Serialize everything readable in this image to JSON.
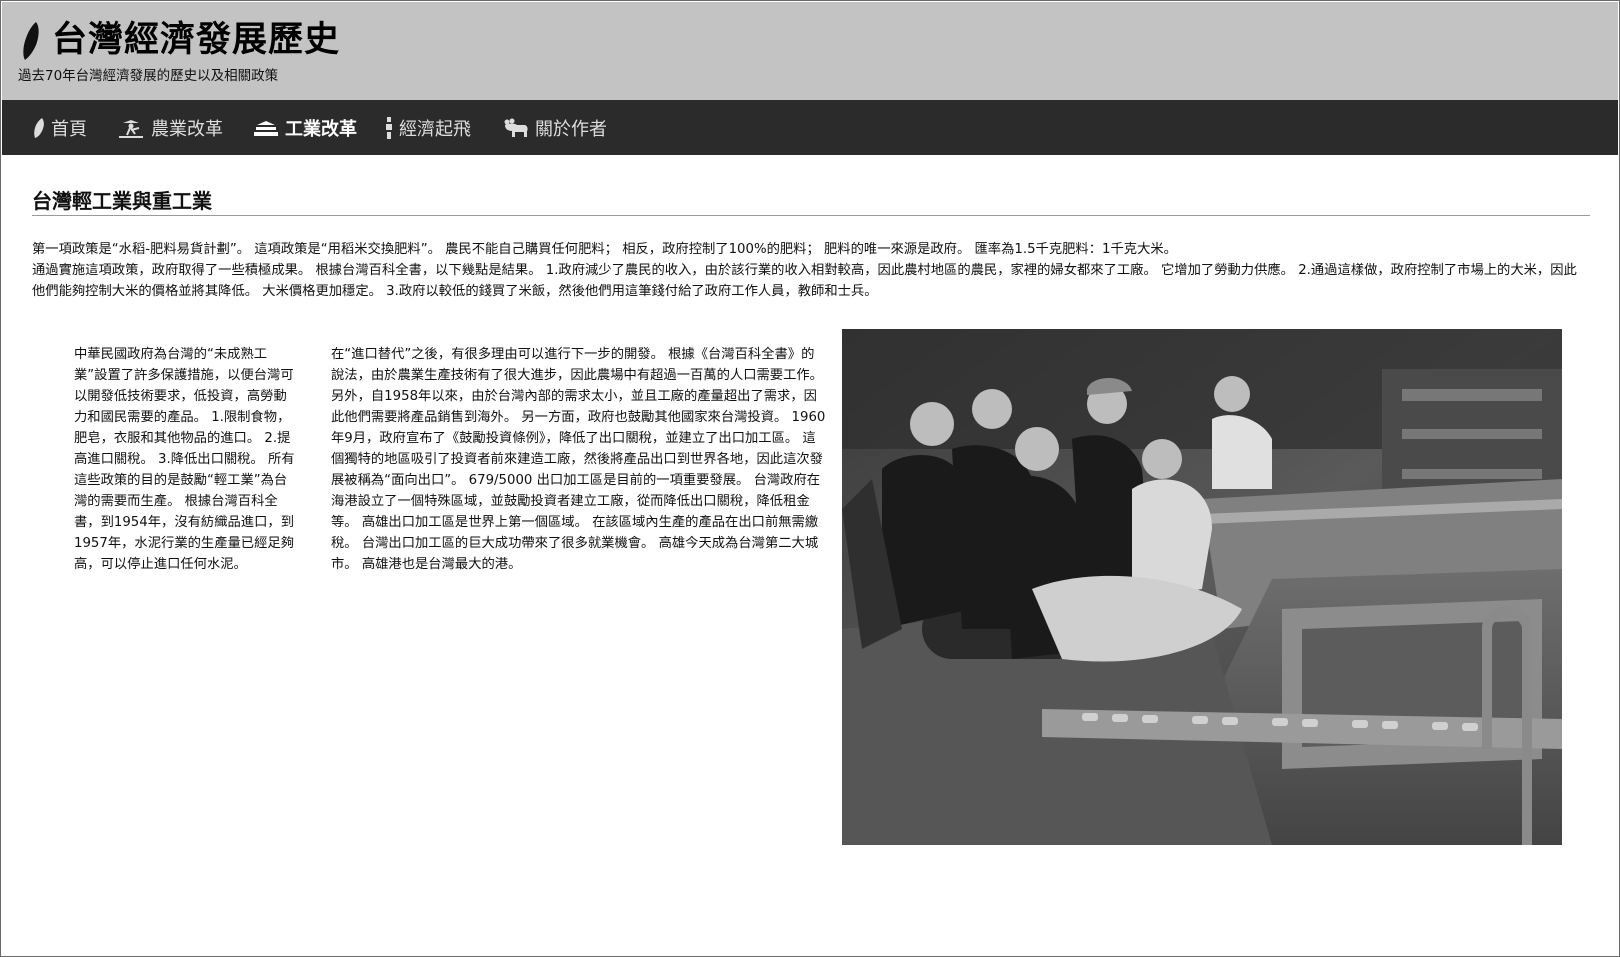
{
  "header": {
    "title": "台灣經濟發展歷史",
    "subtitle": "過去70年台灣經濟發展的歷史以及相關政策",
    "logo_icon": "taiwan-island-icon"
  },
  "nav": {
    "items": [
      {
        "label": "首頁",
        "icon": "taiwan-island-icon",
        "active": false
      },
      {
        "label": "農業改革",
        "icon": "farmer-icon",
        "active": false
      },
      {
        "label": "工業改革",
        "icon": "factory-icon",
        "active": true
      },
      {
        "label": "經濟起飛",
        "icon": "tower-icon",
        "active": false
      },
      {
        "label": "關於作者",
        "icon": "bear-icon",
        "active": false
      }
    ]
  },
  "main": {
    "heading": "台灣輕工業與重工業",
    "intro": [
      "第一項政策是“水稻-肥料易貨計劃”。 這項政策是“用稻米交換肥料”。 農民不能自己購買任何肥料； 相反，政府控制了100%的肥料； 肥料的唯一來源是政府。 匯率為1.5千克肥料：1千克大米。",
      "通過實施這項政策，政府取得了一些積極成果。 根據台灣百科全書，以下幾點是結果。 1.政府減少了農民的收入，由於該行業的收入相對較高，因此農村地區的農民，家裡的婦女都來了工廠。 它增加了勞動力供應。 2.通過這樣做，政府控制了市場上的大米，因此他們能夠控制大米的價格並將其降低。 大米價格更加穩定。 3.政府以較低的錢買了米飯，然後他們用這筆錢付給了政府工作人員，教師和士兵。"
    ],
    "column1": "中華民國政府為台灣的“未成熟工業”設置了許多保護措施，以便台灣可以開發低技術要求，低投資，高勞動力和國民需要的產品。 1.限制食物，肥皂，衣服和其他物品的進口。 2.提高進口關稅。 3.降低出口關稅。 所有這些政策的目的是鼓勵“輕工業”為台灣的需要而生產。 根據台灣百科全書，到1954年，沒有紡織品進口，到1957年，水泥行業的生產量已經足夠高，可以停止進口任何水泥。",
    "column2": "在“進口替代”之後，有很多理由可以進行下一步的開發。 根據《台灣百科全書》的說法，由於農業生產技術有了很大進步，因此農場中有超過一百萬的人口需要工作。 另外，自1958年以來，由於台灣內部的需求太小，並且工廠的產量超出了需求，因此他們需要將產品銷售到海外。 另一方面，政府也鼓勵其他國家來台灣投資。 1960年9月，政府宣布了《鼓勵投資條例》，降低了出口關稅，並建立了出口加工區。 這個獨特的地區吸引了投資者前來建造工廠，然後將產品出口到世界各地，因此這次發展被稱為“面向出口”。 679/5000 出口加工區是目前的一項重要發展。 台灣政府在海港設立了一個特殊區域，並鼓勵投資者建立工廠，從而降低出口關稅，降低租金等。 高雄出口加工區是世界上第一個區域。 在該區域內生產的產品在出口前無需繳稅。 台灣出口加工區的巨大成功帶來了很多就業機會。 高雄今天成為台灣第二大城市。 高雄港也是台灣最大的港。"
  },
  "colors": {
    "header_bg": "#c3c3c3",
    "nav_bg": "#2b2b2b",
    "nav_text": "#dddddd",
    "nav_active_text": "#ffffff"
  }
}
